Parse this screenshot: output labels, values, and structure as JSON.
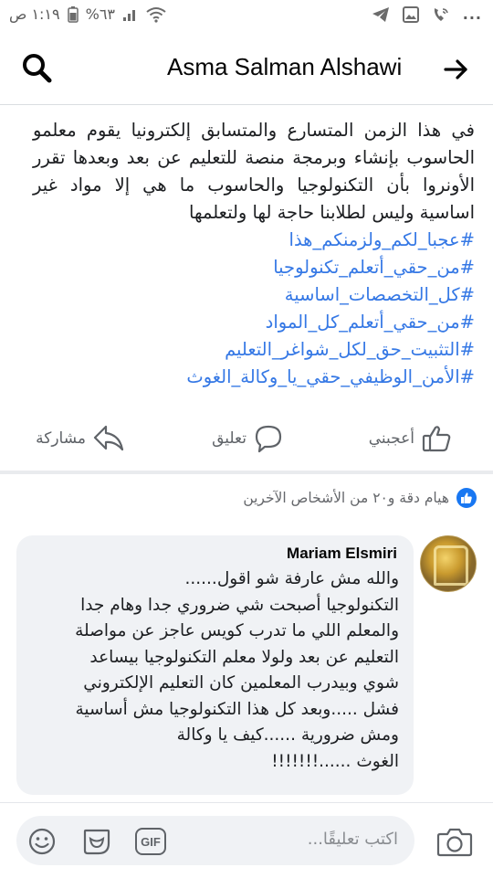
{
  "status_bar": {
    "time": "١:١٩ ص",
    "battery": "%٦٣",
    "notification_icons": [
      "telegram-icon",
      "gallery-icon",
      "wifi-call-icon"
    ],
    "more": "..."
  },
  "header": {
    "title": "Asma Salman Alshawi",
    "icons": [
      "search-icon",
      "arrow-right-icon"
    ]
  },
  "post": {
    "body": "في هذا الزمن المتسارع والمتسابق إلكترونيا يقوم معلمو الحاسوب بإنشاء وبرمجة منصة للتعليم عن بعد وبعدها تقرر الأونروا بأن التكنولوجيا والحاسوب ما هي إلا مواد غير اساسية وليس لطلابنا حاجة لها ولتعلمها",
    "hashtags": [
      "#عجبا_لكم_ولزمنكم_هذا",
      "#من_حقي_أتعلم_تكنولوجيا",
      "#كل_التخصصات_اساسية",
      "#من_حقي_أتعلم_كل_المواد",
      "#التثبيت_حق_لكل_شواغر_التعليم",
      "#الأمن_الوظيفي_حقي_يا_وكالة_الغوث"
    ],
    "hashtag_color": "#3578e5"
  },
  "actions": {
    "like": "أعجبني",
    "comment": "تعليق",
    "share": "مشاركة"
  },
  "reactions": {
    "summary": "هيام دقة و٢٠ من الأشخاص الآخرين",
    "icon": "like-badge-icon"
  },
  "comment": {
    "author": "Mariam Elsmiri",
    "lines": [
      "والله مش عارفة شو اقول......",
      "التكنولوجيا أصبحت شي ضروري جدا وهام جدا",
      "والمعلم اللي ما تدرب كويس عاجز عن مواصلة",
      "التعليم عن بعد ولولا معلم التكنولوجيا بيساعد",
      "شوي وبيدرب المعلمين كان التعليم الإلكتروني",
      "فشل .....وبعد كل هذا التكنولوجيا مش أساسية",
      "ومش ضرورية ......كيف يا وكالة",
      "الغوث ......!!!!!!!"
    ]
  },
  "composer": {
    "placeholder": "اكتب تعليقًا...",
    "gif_label": "GIF",
    "icons": [
      "camera-icon",
      "gif-icon",
      "sticker-icon",
      "emoji-icon"
    ]
  },
  "colors": {
    "accent": "#1877f2",
    "text": "#1c1e21",
    "secondary": "#65676b"
  }
}
